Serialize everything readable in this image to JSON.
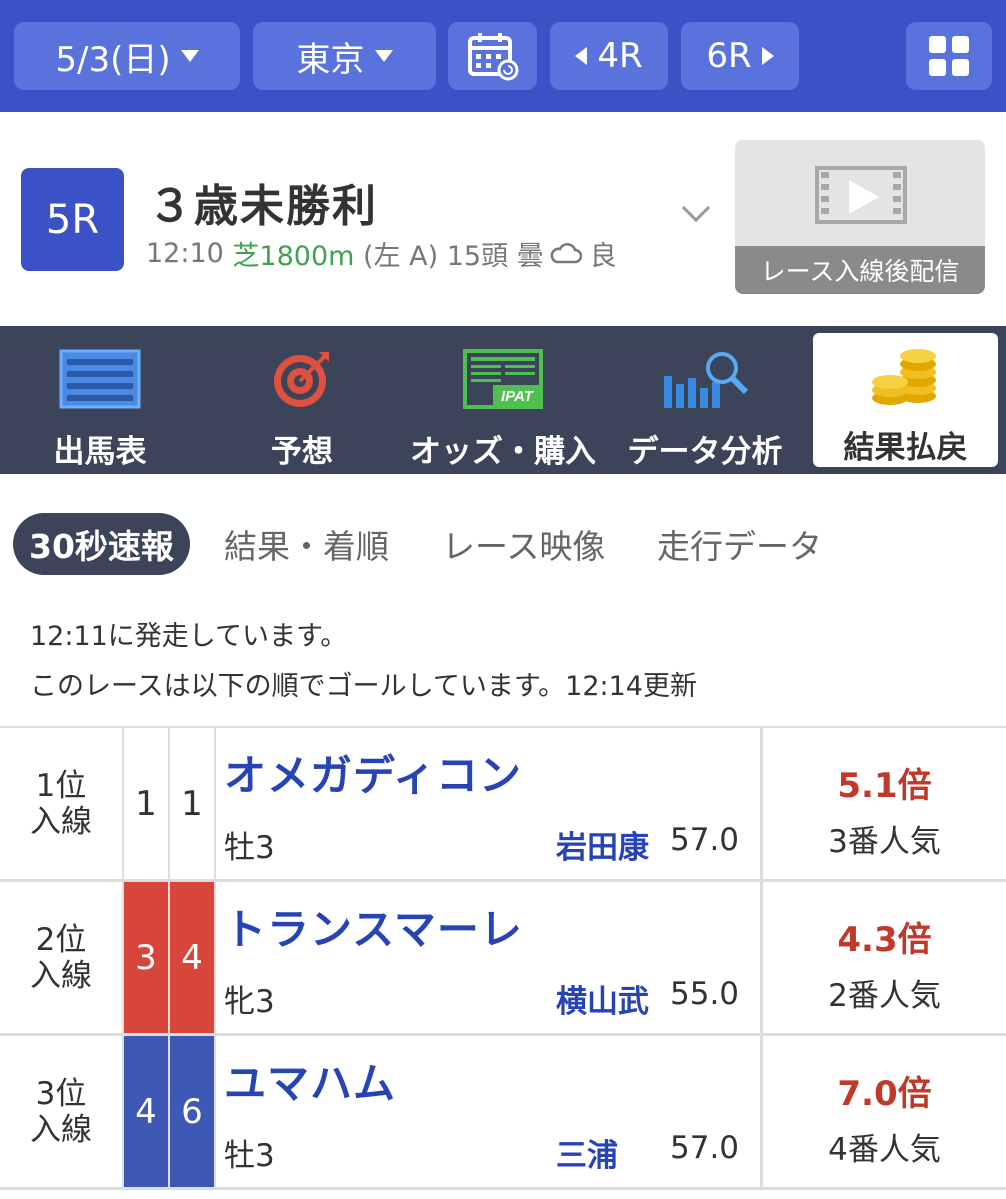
{
  "nav": {
    "date": "5/3(日)",
    "venue": "東京",
    "prev_race": "4R",
    "next_race": "6R"
  },
  "race": {
    "number": "5R",
    "name": "３歳未勝利",
    "time": "12:10",
    "course": "芝1800m",
    "direction": "(左 A)",
    "runners": "15頭",
    "weather": "曇",
    "condition": "良",
    "video_label": "レース入線後配信"
  },
  "menu": [
    {
      "label": "出馬表",
      "icon": "entry-list-icon"
    },
    {
      "label": "予想",
      "icon": "target-icon"
    },
    {
      "label": "オッズ・購入",
      "icon": "ipat-icon"
    },
    {
      "label": "データ分析",
      "icon": "data-analysis-icon"
    },
    {
      "label": "結果払戻",
      "icon": "coins-icon",
      "active": true
    }
  ],
  "tabs": [
    {
      "label": "30秒速報",
      "active": true
    },
    {
      "label": "結果・着順"
    },
    {
      "label": "レース映像"
    },
    {
      "label": "走行データ"
    }
  ],
  "notice": {
    "line1": "12:11に発走しています。",
    "line2": "このレースは以下の順でゴールしています。12:14更新"
  },
  "results": [
    {
      "rank_a": "1位",
      "rank_b": "入線",
      "waku": "1",
      "umaban": "1",
      "horse": "オメガディコン",
      "sex_age": "牡3",
      "jockey": "岩田康",
      "weight": "57.0",
      "odds": "5.1倍",
      "popularity": "3番人気",
      "waku_color": "#ffffff",
      "waku_text": "#333333"
    },
    {
      "rank_a": "2位",
      "rank_b": "入線",
      "waku": "3",
      "umaban": "4",
      "horse": "トランスマーレ",
      "sex_age": "牝3",
      "jockey": "横山武",
      "weight": "55.0",
      "odds": "4.3倍",
      "popularity": "2番人気",
      "waku_color": "#d8453a",
      "waku_text": "#ffffff"
    },
    {
      "rank_a": "3位",
      "rank_b": "入線",
      "waku": "4",
      "umaban": "6",
      "horse": "ユマハム",
      "sex_age": "牡3",
      "jockey": "三浦",
      "weight": "57.0",
      "odds": "7.0倍",
      "popularity": "4番人気",
      "waku_color": "#3e58b6",
      "waku_text": "#ffffff"
    }
  ],
  "colors": {
    "brand_blue": "#3a52c5",
    "menu_bg": "#3c4459",
    "odds_red": "#c0392b",
    "link_blue": "#2744b4",
    "turf_green": "#3fa34d"
  }
}
